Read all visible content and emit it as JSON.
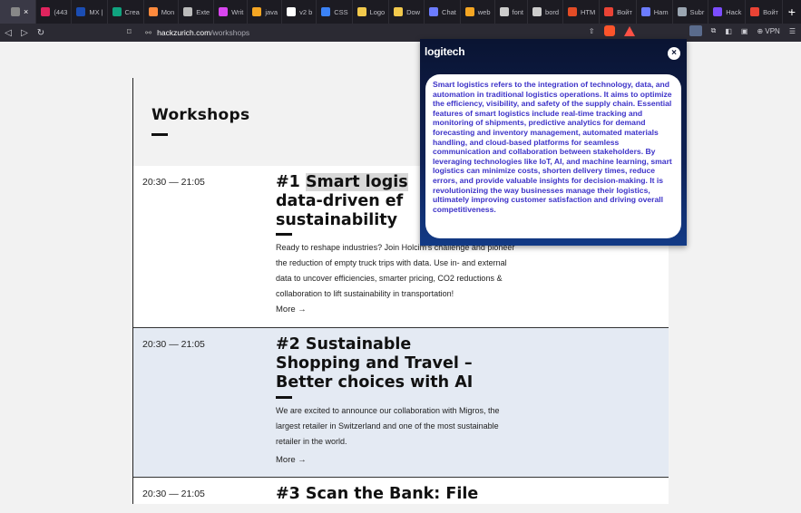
{
  "browser": {
    "tabs": [
      {
        "label": "",
        "color": "#888888",
        "active": true
      },
      {
        "label": "(443",
        "color": "#e0245e"
      },
      {
        "label": "MX |",
        "color": "#1b4db3"
      },
      {
        "label": "Crea",
        "color": "#10a37f"
      },
      {
        "label": "Mon",
        "color": "#ff8a3d"
      },
      {
        "label": "Exte",
        "color": "#bbbbbb"
      },
      {
        "label": "Writ",
        "color": "#d946ef"
      },
      {
        "label": "java",
        "color": "#f5a623"
      },
      {
        "label": "v2 b",
        "color": "#ffffff"
      },
      {
        "label": "CSS",
        "color": "#3b82f6"
      },
      {
        "label": "Logo",
        "color": "#f2c94c"
      },
      {
        "label": "Dow",
        "color": "#f2c94c"
      },
      {
        "label": "Chat",
        "color": "#6c7cff"
      },
      {
        "label": "web",
        "color": "#f5a623"
      },
      {
        "label": "font",
        "color": "#cccccc"
      },
      {
        "label": "bord",
        "color": "#cccccc"
      },
      {
        "label": "HTM",
        "color": "#e34c26"
      },
      {
        "label": "Войт",
        "color": "#ea4335"
      },
      {
        "label": "Ham",
        "color": "#6c7cff"
      },
      {
        "label": "Subr",
        "color": "#9aa5b1"
      },
      {
        "label": "Hack",
        "color": "#7c4dff"
      },
      {
        "label": "Войт",
        "color": "#ea4335"
      }
    ],
    "new_tab": "+",
    "tab_close": "×",
    "tab_dropdown": "⌄",
    "url_domain": "hackzurich.com",
    "url_path": "/workshops",
    "vpn_label": "VPN"
  },
  "page": {
    "heading": "Workshops",
    "workshops": [
      {
        "time": "20:30 — 21:05",
        "title_parts": [
          "#1 ",
          "Smart logis",
          "data-driven ef",
          "sustainability"
        ],
        "description_lines": [
          "Ready to reshape industries? Join Holcim's challenge and pioneer",
          "the reduction of empty truck trips with data. Use in- and external",
          "data to uncover efficiencies, smarter pricing, CO2 reductions &",
          "collaboration to lift sustainability in transportation!"
        ],
        "more": "More →"
      },
      {
        "time": "20:30 — 21:05",
        "title_lines": [
          "#2 Sustainable",
          "Shopping and Travel –",
          "Better choices with AI"
        ],
        "description_lines": [
          "We are excited to announce our collaboration with Migros, the",
          "largest retailer in Switzerland and one of the most sustainable",
          "retailer in the world."
        ],
        "more": "More →"
      },
      {
        "time": "20:30 — 21:05",
        "title_lines": [
          "#3 Scan the Bank: File"
        ]
      }
    ]
  },
  "popup": {
    "logo": "logitech",
    "close": "×",
    "text": "Smart logistics refers to the integration of technology, data, and automation in traditional logistics operations. It aims to optimize the efficiency, visibility, and safety of the supply chain. Essential features of smart logistics include real-time tracking and monitoring of shipments, predictive analytics for demand forecasting and inventory management, automated materials handling, and cloud-based platforms for seamless communication and collaboration between stakeholders. By leveraging technologies like IoT, AI, and machine learning, smart logistics can minimize costs, shorten delivery times, reduce errors, and provide valuable insights for decision-making. It is revolutionizing the way businesses manage their logistics, ultimately improving customer satisfaction and driving overall competitiveness."
  }
}
